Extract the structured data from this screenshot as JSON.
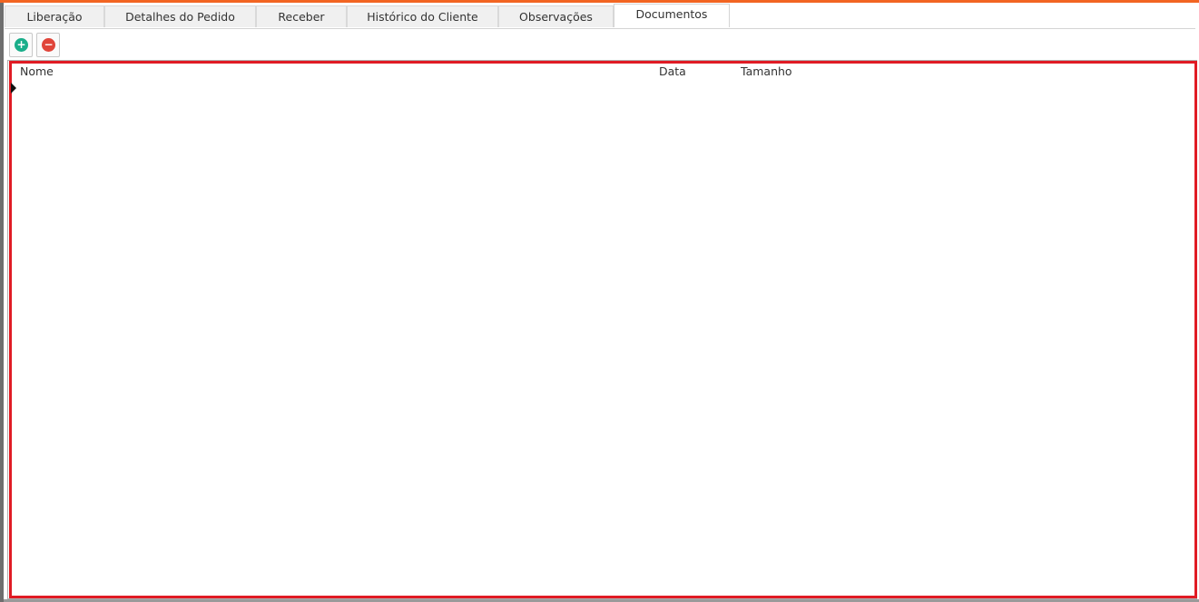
{
  "tabs": [
    {
      "label": "Liberação"
    },
    {
      "label": "Detalhes do Pedido"
    },
    {
      "label": "Receber"
    },
    {
      "label": "Histórico do Cliente"
    },
    {
      "label": "Observações"
    },
    {
      "label": "Documentos",
      "active": true
    }
  ],
  "toolbar": {
    "add_icon": "plus-circle-icon",
    "add_glyph": "+",
    "remove_icon": "minus-circle-icon",
    "remove_glyph": "−"
  },
  "grid": {
    "columns": [
      "Nome",
      "Data",
      "Tamanho"
    ],
    "rows": []
  },
  "colors": {
    "accent": "#f26522",
    "add": "#1aae8a",
    "remove": "#e0453a",
    "highlight": "#e01b24"
  }
}
